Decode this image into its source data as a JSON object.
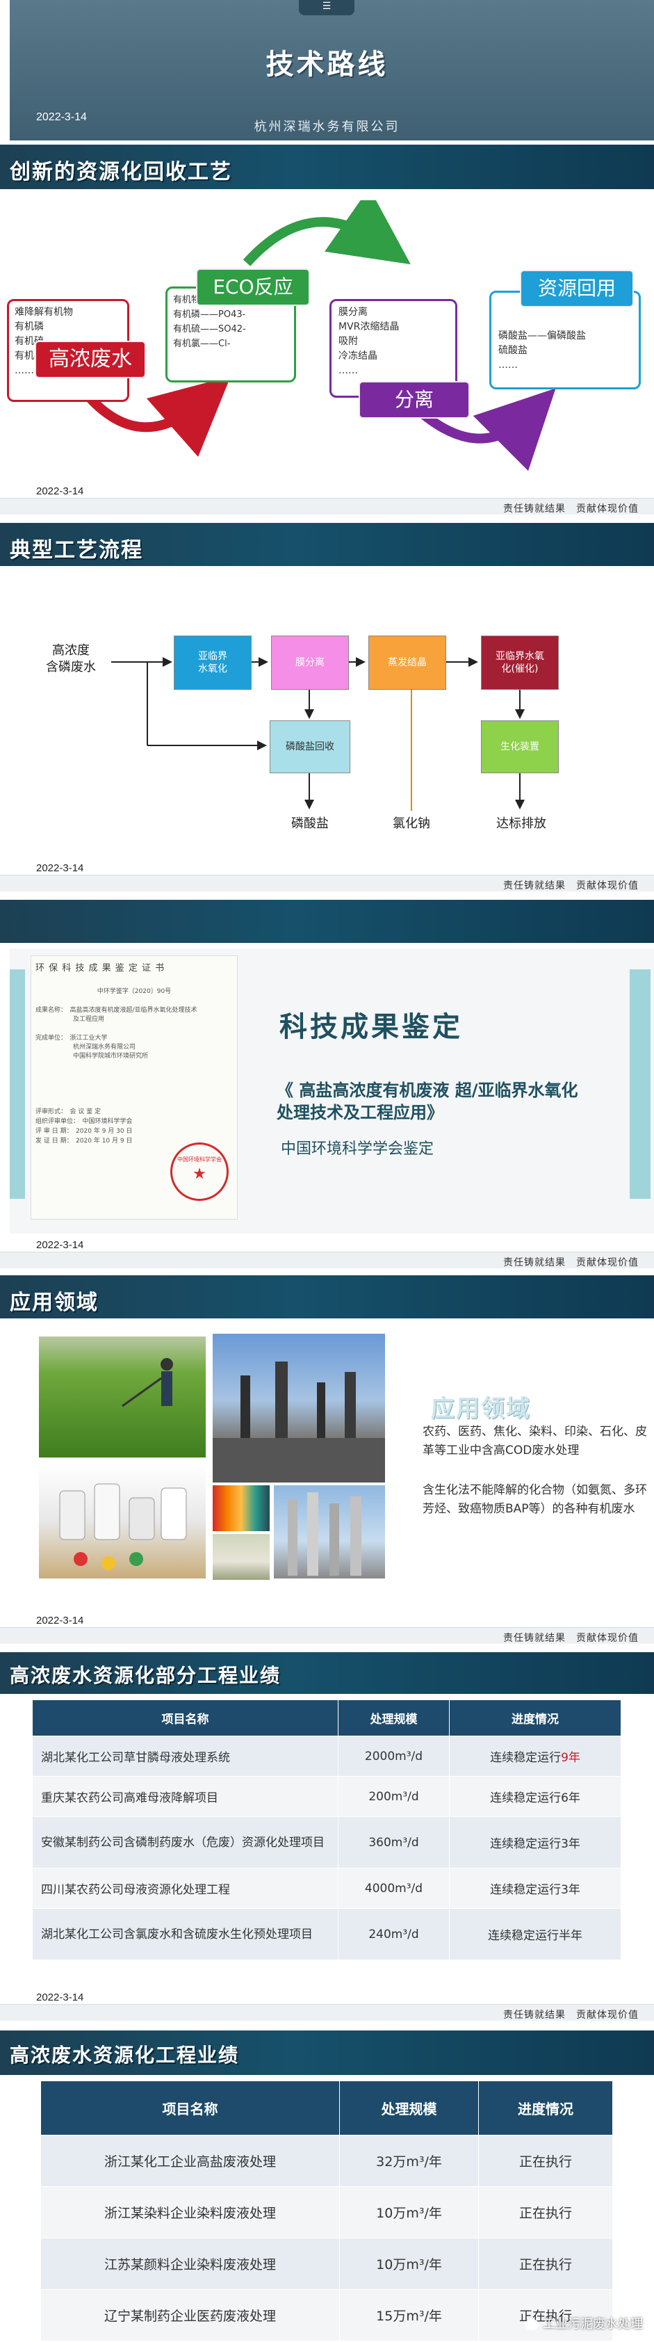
{
  "slide1": {
    "title": "技术路线",
    "date": "2022-3-14",
    "company": "杭州深瑞水务有限公司"
  },
  "slide2": {
    "heading": "创新的资源化回收工艺",
    "wastewater": {
      "title": "高浓废水",
      "items": [
        "难降解有机物",
        "有机磷",
        "有机硫",
        "有机氯",
        "……"
      ]
    },
    "eco": {
      "title": "ECO反应",
      "items": [
        "有机物——CO2、H2O、N2",
        "有机磷——PO43-",
        "有机硫——SO42-",
        "有机氯——Cl-"
      ]
    },
    "separation": {
      "title": "分离",
      "items": [
        "膜分离",
        "MVR浓缩结晶",
        "吸附",
        "冷冻结晶",
        "……"
      ]
    },
    "reuse": {
      "title": "资源回用",
      "items": [
        "磷酸盐——偏磷酸盐",
        "硫酸盐",
        "……"
      ]
    },
    "date": "2022-3-14",
    "footer": "责任铸就结果　贡献体现价值"
  },
  "slide3": {
    "heading": "典型工艺流程",
    "input": "高浓度\n含磷废水",
    "nodes": {
      "n1": "亚临界\n水氧化",
      "n2": "膜分离",
      "n3": "蒸发结晶",
      "n4": "亚临界水氧\n化(催化)",
      "n5": "磷酸盐回收",
      "n6": "生化装置"
    },
    "outputs": {
      "o1": "磷酸盐",
      "o2": "氯化钠",
      "o3": "达标排放"
    },
    "date": "2022-3-14",
    "footer": "责任铸就结果　贡献体现价值"
  },
  "slide4": {
    "cert_header": "环 保 科 技 成 果 鉴 定 证 书",
    "cert_no": "中环学鉴字〔2020〕90号",
    "cert_rows": [
      "成果名称：　高盐高浓度有机废液超/亚临界水氧化处理技术",
      "　　　　　　及工程应用",
      "完成单位：　浙江工业大学",
      "　　　　　　杭州深瑞水务有限公司",
      "　　　　　　中国科学院城市环境研究所"
    ],
    "cert_footer_rows": [
      "评审形式：　会 议 鉴 定",
      "组织评审单位：　中国环境科学学会",
      "评 审 日 期：　2020 年 9 月 30 日",
      "发 证 日 期：　2020 年 10 月 9 日"
    ],
    "title": "科技成果鉴定",
    "subtitle": "《 高盐高浓度有机废液 超/亚临界水氧化处理技术及工程应用》",
    "org": "中国环境科学学会鉴定",
    "seal": "中国环境科学学会",
    "date": "2022-3-14",
    "footer": "责任铸就结果　贡献体现价值"
  },
  "slide5": {
    "heading": "应用领域",
    "sub_heading": "应用领域",
    "p1": "农药、医药、焦化、染料、印染、石化、皮革等工业中含高COD废水处理",
    "p2": "含生化法不能降解的化合物（如氨氮、多环芳烃、致癌物质BAP等）的各种有机废水",
    "date": "2022-3-14",
    "footer": "责任铸就结果　贡献体现价值"
  },
  "slide6": {
    "heading": "高浓废水资源化部分工程业绩",
    "columns": [
      "项目名称",
      "处理规模",
      "进度情况"
    ],
    "rows": [
      [
        "湖北某化工公司草甘膦母液处理系统",
        "2000m³/d",
        "连续稳定运行",
        ".9年"
      ],
      [
        "重庆某农药公司高难母液降解项目",
        "200m³/d",
        "连续稳定运行6年",
        ""
      ],
      [
        "安徽某制药公司含磷制药废水（危废）资源化处理项目",
        "360m³/d",
        "连续稳定运行3年",
        ""
      ],
      [
        "四川某农药公司母液资源化处理工程",
        "4000m³/d",
        "连续稳定运行3年",
        ""
      ],
      [
        "湖北某化工公司含氯废水和含硫废水生化预处理项目",
        "240m³/d",
        "连续稳定运行半年",
        ""
      ]
    ],
    "date": "2022-3-14",
    "footer": "责任铸就结果　贡献体现价值"
  },
  "slide7": {
    "heading": "高浓废水资源化工程业绩",
    "columns": [
      "项目名称",
      "处理规模",
      "进度情况"
    ],
    "rows": [
      [
        "浙江某化工企业高盐废液处理",
        "32万m³/年",
        "正在执行"
      ],
      [
        "浙江某染料企业染料废液处理",
        "10万m³/年",
        "正在执行"
      ],
      [
        "江苏某颜料企业染料废液处理",
        "10万m³/年",
        "正在执行"
      ],
      [
        "辽宁某制药企业医药废液处理",
        "15万m³/年",
        "正在执行"
      ]
    ],
    "watermark": "工业污泥废水处理"
  },
  "colors": {
    "band": "#16506a",
    "red": "#c8192b",
    "green": "#2f9e44",
    "purple": "#7a2a9e",
    "blue": "#1e9fd8",
    "table_head": "#1e4b6b"
  }
}
